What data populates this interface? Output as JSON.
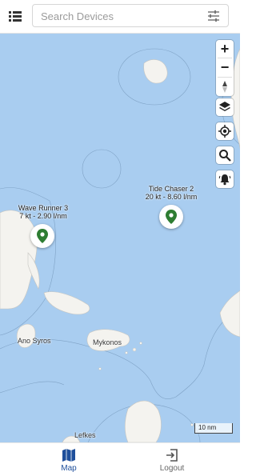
{
  "search": {
    "placeholder": "Search Devices"
  },
  "vessels": [
    {
      "name": "Wave Runner 3",
      "stats": "7 kt - 2.90 l/nm"
    },
    {
      "name": "Tide Chaser 2",
      "stats": "20 kt - 8.60 l/nm"
    }
  ],
  "places": [
    "Ano Syros",
    "Mykonos",
    "Lefkes"
  ],
  "scale_label": "10 nm",
  "map_controls": {
    "zoom_in": "+",
    "zoom_out": "−",
    "icons": [
      "compass-icon",
      "layers-icon",
      "locate-icon",
      "search-icon",
      "alarm-bell-icon"
    ]
  },
  "nav": [
    {
      "label": "Map",
      "icon": "map-icon",
      "active": true
    },
    {
      "label": "Logout",
      "icon": "logout-icon",
      "active": false
    }
  ],
  "colors": {
    "sea": "#a9cdf0",
    "land": "#f4f3ef",
    "pin": "#2e7d32",
    "active": "#1e4f9b",
    "inactive": "#666666"
  }
}
